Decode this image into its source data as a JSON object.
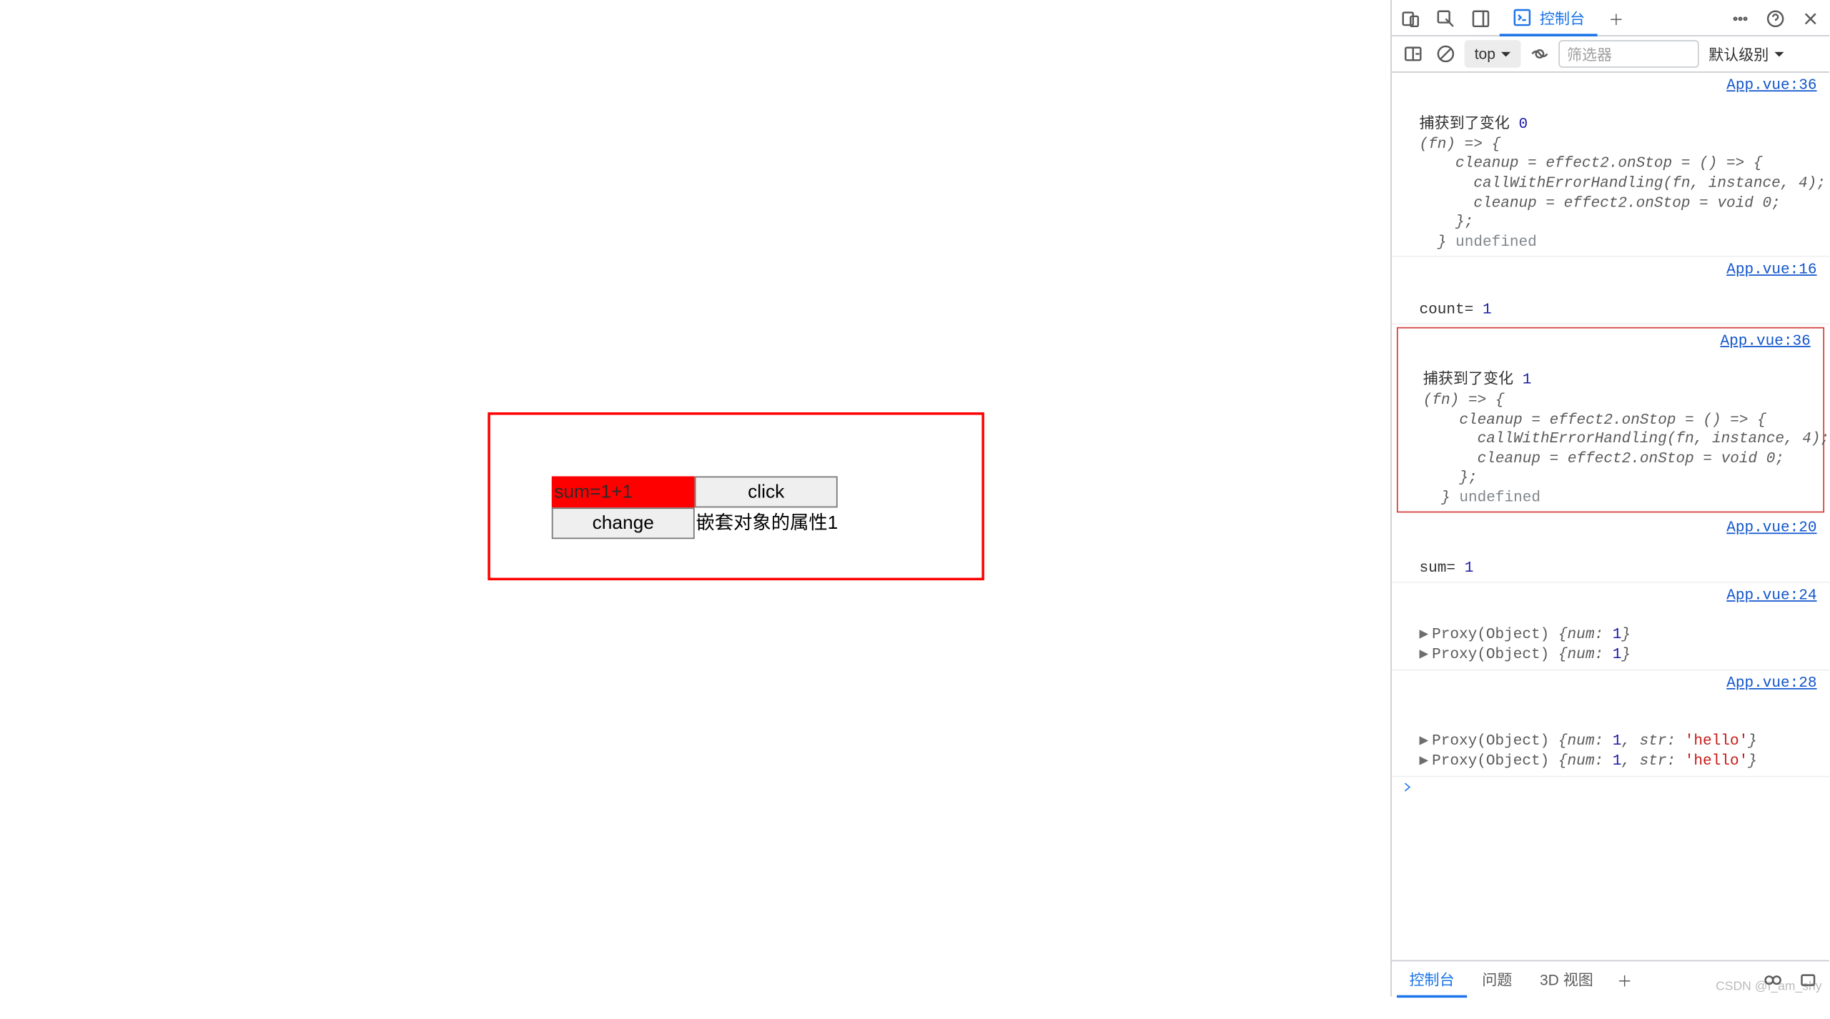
{
  "app": {
    "sum_label": "sum=1+1",
    "click_btn": "click",
    "change_btn": "change",
    "nested_text": "嵌套对象的属性1"
  },
  "devtools": {
    "tabs": {
      "console": "控制台",
      "add": "＋"
    },
    "bar": {
      "context": "top",
      "filter_placeholder": "筛选器",
      "level": "默认级别"
    },
    "logs": {
      "entry1": {
        "src": "App.vue:36",
        "l1": "捕获到了变化",
        "n1": "0",
        "l2": "(fn) => {",
        "l3": "    cleanup = effect2.onStop = () => {",
        "l4": "      callWithErrorHandling(fn, instance, 4);",
        "l5": "      cleanup = effect2.onStop = void 0;",
        "l6": "    };",
        "l7": "  }",
        "undef": "undefined"
      },
      "entry2": {
        "src": "App.vue:16",
        "label": "count=",
        "val": "1"
      },
      "entry3": {
        "src": "App.vue:36",
        "l1": "捕获到了变化",
        "n1": "1",
        "l2": "(fn) => {",
        "l3": "    cleanup = effect2.onStop = () => {",
        "l4": "      callWithErrorHandling(fn, instance, 4);",
        "l5": "      cleanup = effect2.onStop = void 0;",
        "l6": "    };",
        "l7": "  }",
        "undef": "undefined"
      },
      "entry4": {
        "src": "App.vue:20",
        "label": "sum=",
        "val": "1"
      },
      "entry5": {
        "src": "App.vue:24",
        "l1_a": "Proxy(Object)",
        "l1_b": "{num: ",
        "l1_n": "1",
        "l1_c": "}",
        "l2_a": "Proxy(Object)",
        "l2_b": "{num: ",
        "l2_n": "1",
        "l2_c": "}"
      },
      "entry6": {
        "src": "App.vue:28",
        "l1_a": "Proxy(Object)",
        "l1_b": "{num: ",
        "l1_n": "1",
        "l1_c": ", str: ",
        "l1_s": "'hello'",
        "l1_d": "}",
        "l2_a": "Proxy(Object)",
        "l2_b": "{num: ",
        "l2_n": "1",
        "l2_c": ", str: ",
        "l2_s": "'hello'",
        "l2_d": "}"
      }
    },
    "drawer": {
      "console": "控制台",
      "issues": "问题",
      "view3d": "3D 视图",
      "add": "＋"
    },
    "watermark": "CSDN @I_am_shy"
  }
}
